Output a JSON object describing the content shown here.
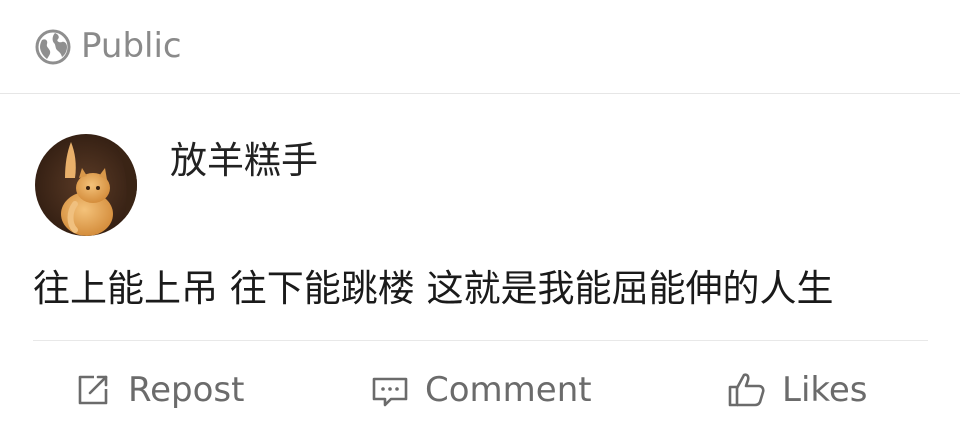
{
  "visibility": {
    "label": "Public",
    "icon": "globe-icon"
  },
  "post": {
    "author": {
      "name": "放羊糕手",
      "avatar": "avatar-cat"
    },
    "text": "往上能上吊 往下能跳楼 这就是我能屈能伸的人生"
  },
  "actions": {
    "repost": {
      "label": "Repost",
      "icon": "repost-icon"
    },
    "comment": {
      "label": "Comment",
      "icon": "comment-icon"
    },
    "likes": {
      "label": "Likes",
      "icon": "thumbs-up-icon"
    }
  },
  "colors": {
    "muted_text": "#8a8a8a",
    "action_text": "#6b6b6b",
    "body_text": "#1a1a1a",
    "divider": "#e6e6e6"
  }
}
